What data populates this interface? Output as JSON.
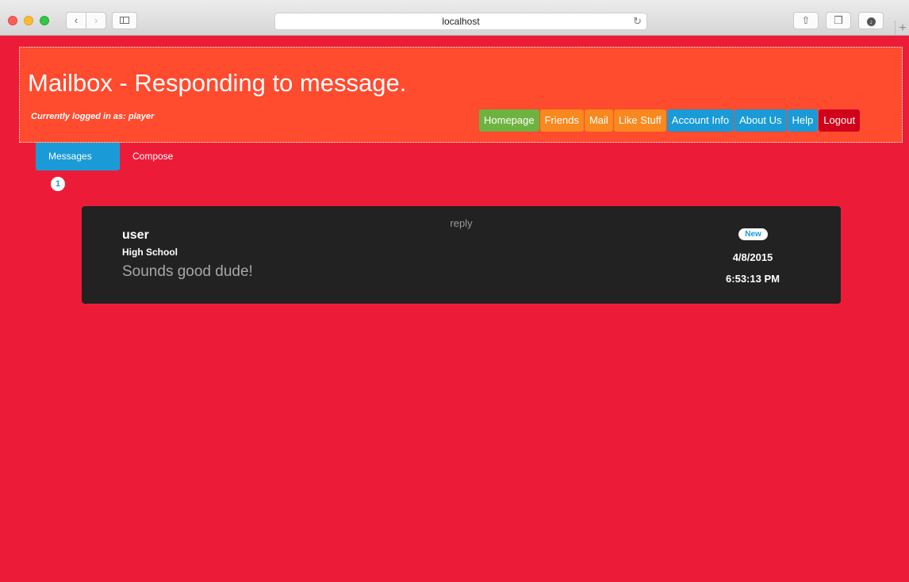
{
  "browser": {
    "url": "localhost",
    "back_glyph": "‹",
    "forward_glyph": "›",
    "reload_glyph": "↻",
    "share_glyph": "⇧",
    "tabs_glyph": "❐",
    "download_glyph": "↓",
    "newtab_glyph": "+"
  },
  "header": {
    "title": "Mailbox - Responding to message.",
    "logged_in_text": "Currently logged in as: player",
    "nav": [
      {
        "label": "Homepage",
        "color": "#6db33f"
      },
      {
        "label": "Friends",
        "color": "#f7891f"
      },
      {
        "label": "Mail",
        "color": "#f7891f"
      },
      {
        "label": "Like Stuff",
        "color": "#f7891f"
      },
      {
        "label": "Account Info",
        "color": "#1a9bd7"
      },
      {
        "label": "About Us",
        "color": "#1a9bd7"
      },
      {
        "label": "Help",
        "color": "#1a9bd7"
      },
      {
        "label": "Logout",
        "color": "#d0021b"
      }
    ]
  },
  "subnav": {
    "messages_label": "Messages",
    "messages_count": "1",
    "compose_label": "Compose"
  },
  "message": {
    "subject": "reply",
    "sender": "user",
    "school": "High School",
    "body": "Sounds good dude!",
    "status": "New",
    "date": "4/8/2015",
    "time": "6:53:13 PM"
  },
  "colors": {
    "page_bg": "#ec1c39",
    "header_bg": "#ff4b2e",
    "card_bg": "#222222",
    "accent_blue": "#1a9bd7"
  }
}
